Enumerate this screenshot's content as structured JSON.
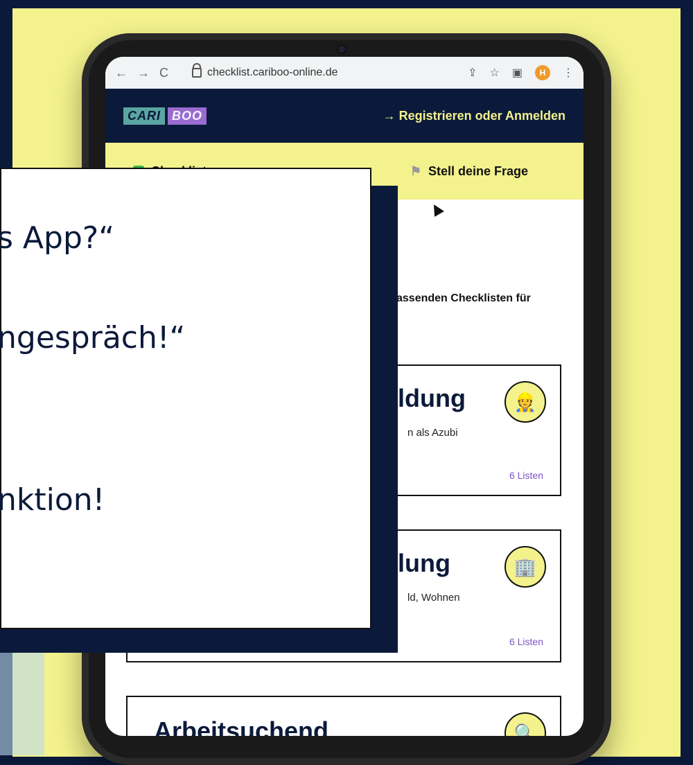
{
  "browser": {
    "url": "checklist.cariboo-online.de",
    "avatar_letter": "H"
  },
  "header": {
    "logo_part1": "CARI",
    "logo_part2": "BOO",
    "register_link": "→ Registrieren oder Anmelden"
  },
  "nav": {
    "left_label": "Checklisten",
    "right_label": "Stell deine Frage"
  },
  "intro": {
    "text_fragment": "assenden Checklisten für"
  },
  "cards": [
    {
      "title": "ldung",
      "desc": "n als Azubi",
      "count": "6 Listen"
    },
    {
      "title": "lung",
      "desc": "ld, Wohnen",
      "count": "6 Listen"
    },
    {
      "title": "Arbeitsuchend"
    }
  ],
  "overlay": {
    "lines": [
      "s App?“",
      "ngespräch!“",
      "nktion!"
    ]
  },
  "colors": {
    "navy": "#0b1a3a",
    "yellow": "#f3f28d",
    "purple": "#7b53c7"
  }
}
